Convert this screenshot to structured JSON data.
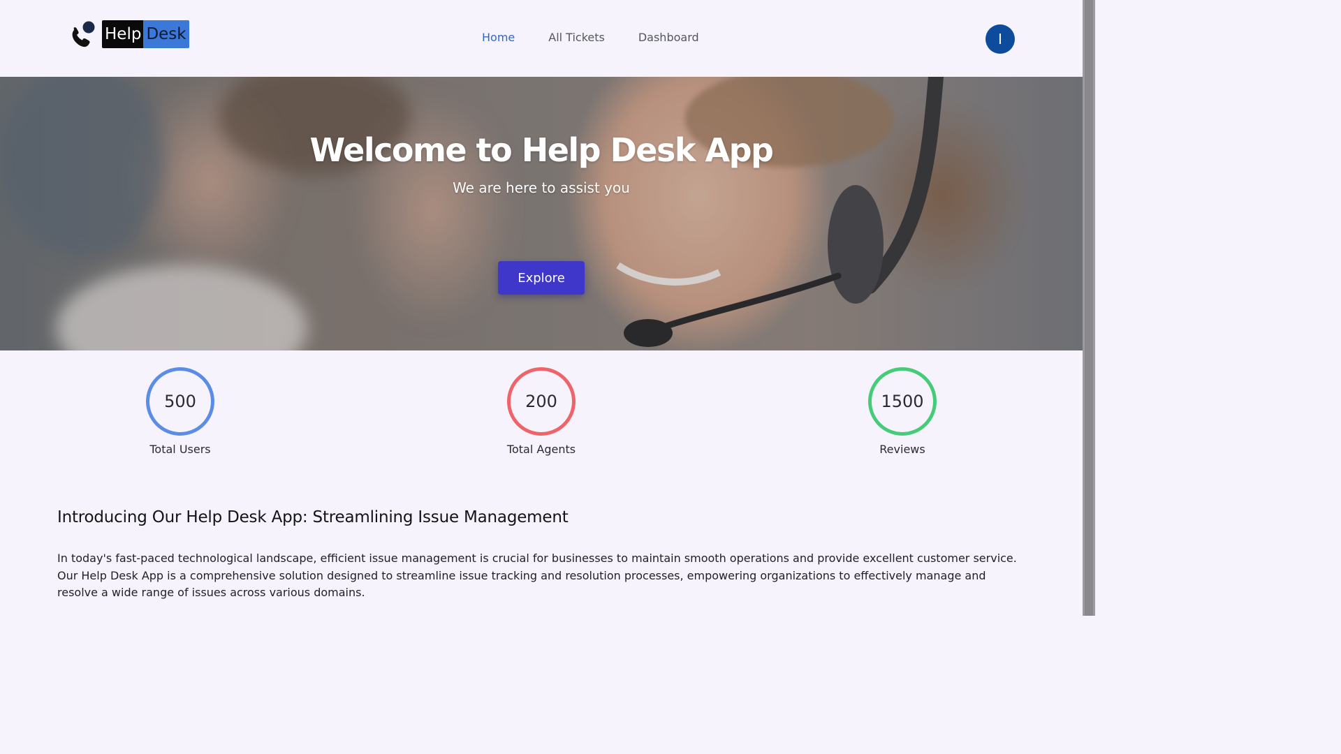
{
  "brand": {
    "help": "Help",
    "desk": "Desk"
  },
  "nav": {
    "items": [
      {
        "label": "Home",
        "active": true
      },
      {
        "label": "All Tickets",
        "active": false
      },
      {
        "label": "Dashboard",
        "active": false
      }
    ],
    "avatar_initial": "I"
  },
  "hero": {
    "title": "Welcome to Help Desk App",
    "subtitle": "We are here to assist you",
    "button_label": "Explore"
  },
  "stats": [
    {
      "value": "500",
      "label": "Total Users",
      "color": "#5b8de6"
    },
    {
      "value": "200",
      "label": "Total Agents",
      "color": "#ee6468"
    },
    {
      "value": "1500",
      "label": "Reviews",
      "color": "#46cc78"
    }
  ],
  "intro": {
    "title": "Introducing Our Help Desk App: Streamlining Issue Management",
    "body": "In today's fast-paced technological landscape, efficient issue management is crucial for businesses to maintain smooth operations and provide excellent customer service. Our Help Desk App is a comprehensive solution designed to streamline issue tracking and resolution processes, empowering organizations to effectively manage and resolve a wide range of issues across various domains."
  },
  "colors": {
    "accent": "#3f37c9",
    "nav_active": "#2f68c9",
    "avatar": "#0d4b9c",
    "page_bg": "#f6f3fc"
  }
}
